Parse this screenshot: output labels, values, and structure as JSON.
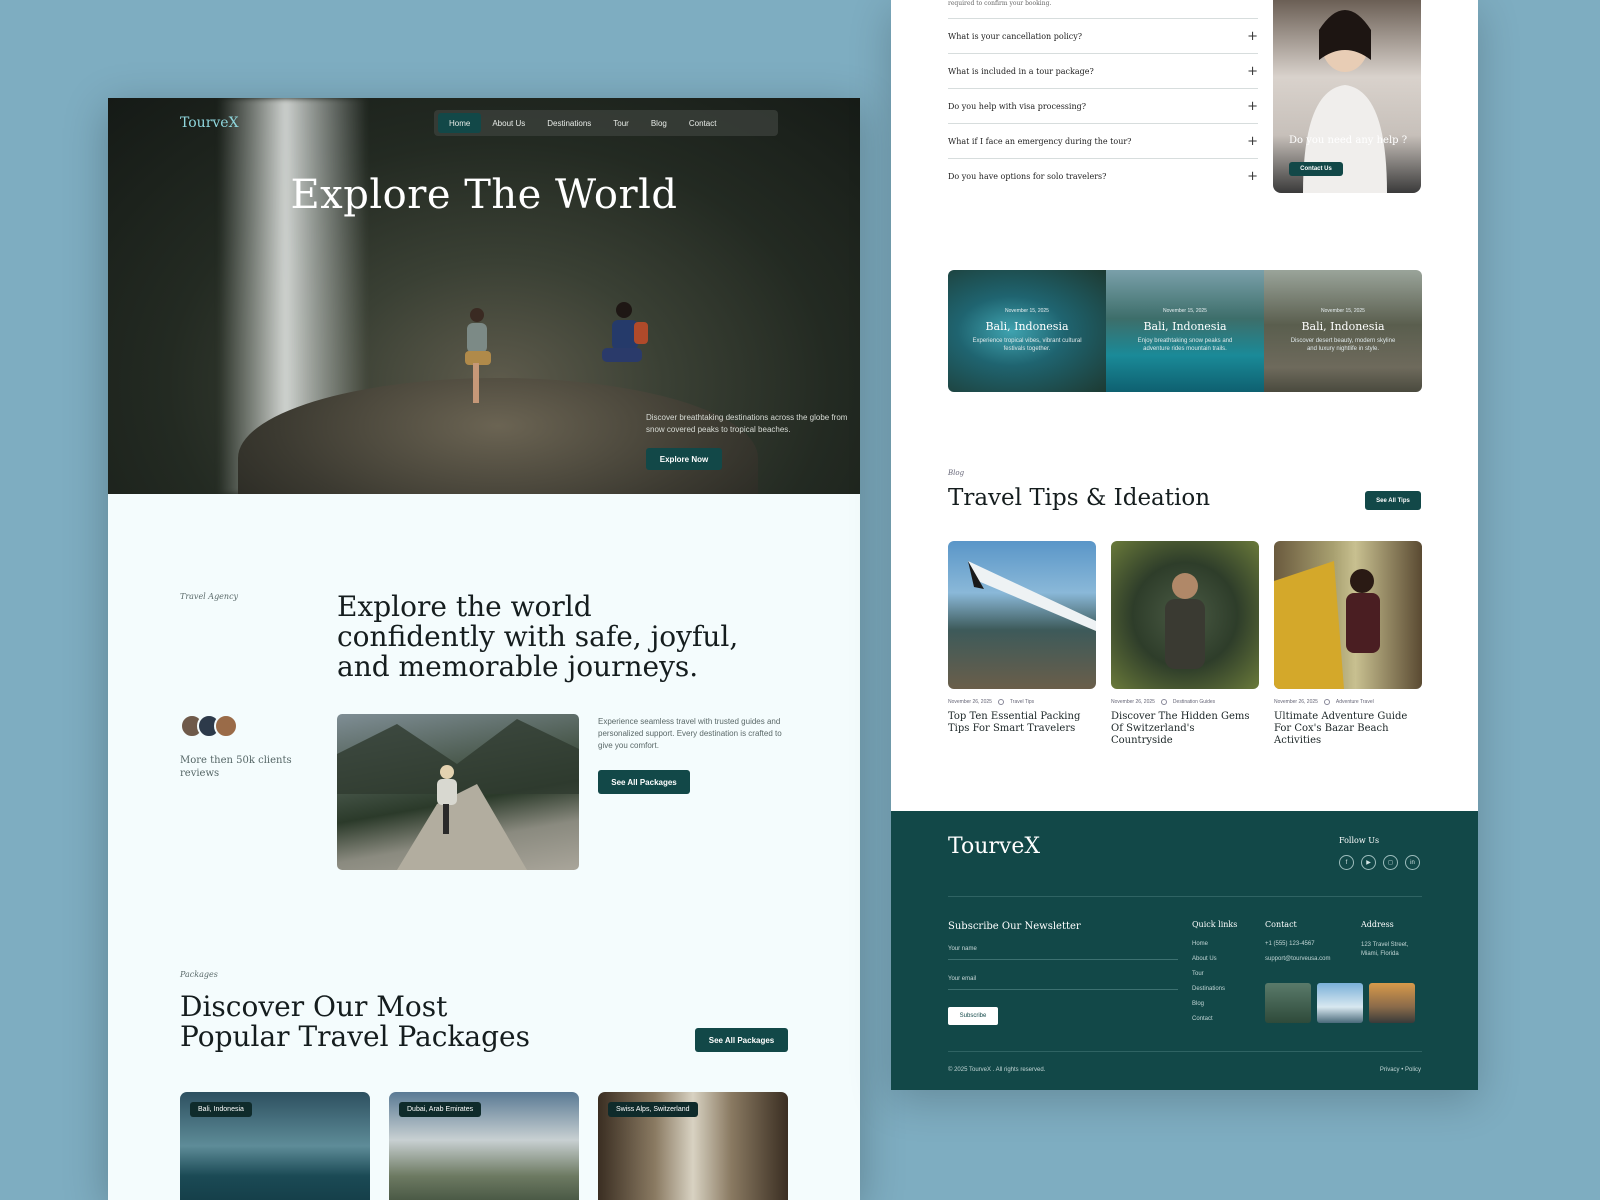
{
  "left_page": {
    "nav": {
      "logo": "TourveX",
      "items": [
        "Home",
        "About Us",
        "Destinations",
        "Tour",
        "Blog",
        "Contact"
      ]
    },
    "hero": {
      "title": "Explore The World",
      "description": "Discover breathtaking destinations across the globe from snow covered peaks to tropical beaches.",
      "button": "Explore Now"
    },
    "agency": {
      "label": "Travel Agency",
      "heading": "Explore the world confidently with safe, joyful, and memorable journeys.",
      "clients": "More then 50k clients reviews",
      "description": "Experience seamless travel with trusted guides and personalized support. Every destination is crafted to give you comfort.",
      "button": "See All Packages"
    },
    "packages": {
      "label": "Packages",
      "title": "Discover Our Most Popular Travel Packages",
      "button": "See All Packages",
      "cards": [
        {
          "tag": "Bali, Indonesia"
        },
        {
          "tag": "Dubai, Arab Emirates"
        },
        {
          "tag": "Swiss Alps, Switzerland"
        }
      ]
    }
  },
  "right_page": {
    "faq_top_text": "required to confirm your booking.",
    "faq": [
      "What is your cancellation policy?",
      "What is included in a tour package?",
      "Do you help with visa processing?",
      "What if I face an emergency during the tour?",
      "Do you have options for solo travelers?"
    ],
    "help": {
      "text": "Do you need any help ?",
      "button": "Contact Us"
    },
    "destinations": [
      {
        "date": "November 15, 2025",
        "title": "Bali, Indonesia",
        "desc": "Experience tropical vibes, vibrant cultural festivals together."
      },
      {
        "date": "November 15, 2025",
        "title": "Bali, Indonesia",
        "desc": "Enjoy breathtaking snow peaks and adventure rides mountain trails."
      },
      {
        "date": "November 15, 2025",
        "title": "Bali, Indonesia",
        "desc": "Discover desert beauty, modern skyline and luxury nightlife in style."
      }
    ],
    "blog": {
      "label": "Blog",
      "title": "Travel Tips & Ideation",
      "button": "See All Tips",
      "posts": [
        {
          "date": "November 26, 2025",
          "category": "Travel Tips",
          "title": "Top Ten Essential Packing Tips For Smart Travelers"
        },
        {
          "date": "November 26, 2025",
          "category": "Destination Guides",
          "title": "Discover The Hidden Gems Of Switzerland's Countryside"
        },
        {
          "date": "November 26, 2025",
          "category": "Adventure Travel",
          "title": "Ultimate Adventure Guide For Cox's Bazar Beach Activities"
        }
      ]
    },
    "footer": {
      "logo": "TourveX",
      "follow": "Follow Us",
      "newsletter": "Subscribe Our Newsletter",
      "name_placeholder": "Your name",
      "email_placeholder": "Your email",
      "subscribe": "Subscribe",
      "quick_links_title": "Quick links",
      "quick_links": [
        "Home",
        "About Us",
        "Tour",
        "Destinations",
        "Blog",
        "Contact"
      ],
      "contact_title": "Contact",
      "phone": "+1 (555) 123-4567",
      "email": "support@tourveusa.com",
      "address_title": "Address",
      "address": "123 Travel Street, Miami, Florida",
      "copyright": "© 2025 TourveX . All rights reserved.",
      "policy": "Privacy • Policy"
    }
  }
}
